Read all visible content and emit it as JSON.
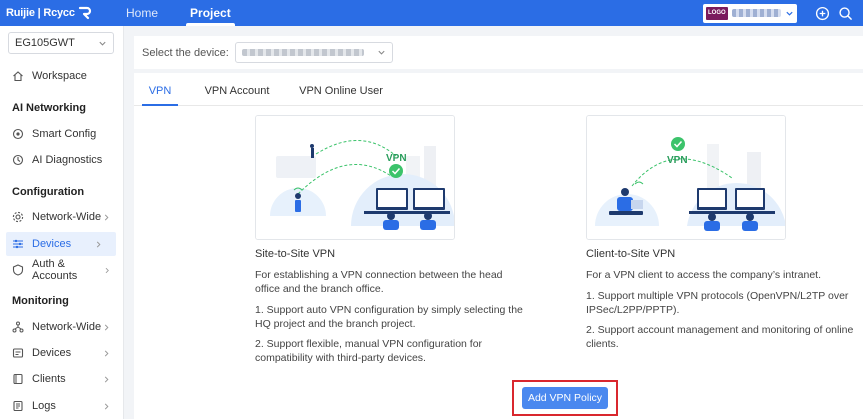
{
  "brand": {
    "name": "Ruijie | Rcycc"
  },
  "nav": {
    "home": "Home",
    "project": "Project"
  },
  "topbar": {
    "logo_chip": "LOGO"
  },
  "sidebar": {
    "device": "EG105GWT",
    "workspace": "Workspace",
    "sections": {
      "ai": "AI Networking",
      "config": "Configuration",
      "monitoring": "Monitoring"
    },
    "items": {
      "smart_config": "Smart Config",
      "ai_diagnostics": "AI Diagnostics",
      "network_wide": "Network-Wide",
      "devices": "Devices",
      "auth_accounts": "Auth & Accounts",
      "mon_network_wide": "Network-Wide",
      "mon_devices": "Devices",
      "mon_clients": "Clients",
      "mon_logs": "Logs"
    }
  },
  "device_bar": {
    "label": "Select the device:"
  },
  "tabs": {
    "vpn": "VPN",
    "vpn_account": "VPN Account",
    "vpn_online_user": "VPN Online User"
  },
  "cards": {
    "site": {
      "badge": "VPN",
      "title": "Site-to-Site VPN",
      "desc": "For establishing a VPN connection between the head office and the branch office.",
      "point1": "1. Support auto VPN configuration by simply selecting the HQ project and the branch project.",
      "point2": "2. Support flexible, manual VPN configuration for compatibility with third-party devices."
    },
    "client": {
      "badge": "VPN",
      "title": "Client-to-Site VPN",
      "desc": "For a VPN client to access the company’s intranet.",
      "point1": "1. Support multiple VPN protocols (OpenVPN/L2TP over IPSec/L2PP/PPTP).",
      "point2": "2. Support account management and monitoring of online clients."
    }
  },
  "actions": {
    "add_vpn_policy": "Add VPN Policy"
  },
  "colors": {
    "primary": "#2b6de5",
    "button": "#4a88ef",
    "highlight": "#d9272e",
    "check": "#3cc36b"
  }
}
